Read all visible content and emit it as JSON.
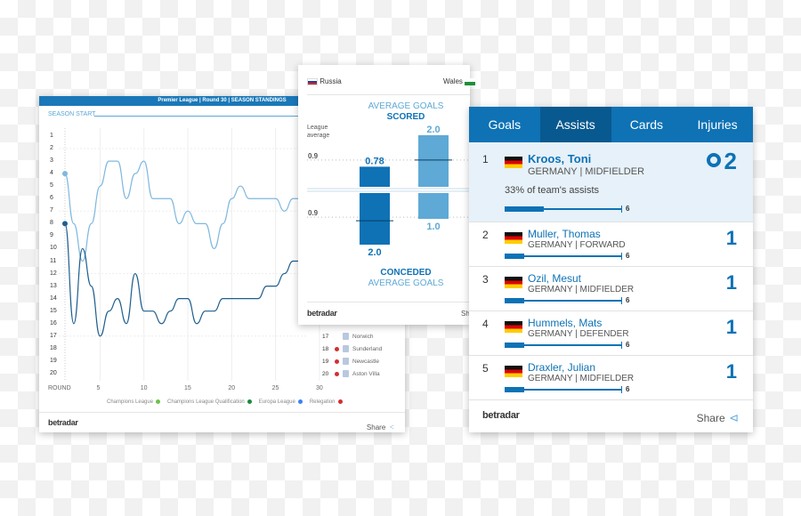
{
  "standings_card": {
    "header": "Premier League | Round 30 | SEASON STANDINGS",
    "season_start": "SEASON START",
    "round_label": "ROUND",
    "legend": [
      {
        "label": "Champions League",
        "color": "#6cc24a"
      },
      {
        "label": "Champions League Qualification",
        "color": "#1b8a3a"
      },
      {
        "label": "Europa League",
        "color": "#3b82f6"
      },
      {
        "label": "Relegation",
        "color": "#d32f2f"
      }
    ],
    "table": [
      {
        "pos": "17",
        "team": "Norwich",
        "zone": ""
      },
      {
        "pos": "18",
        "team": "Sunderland",
        "zone": "#d32f2f"
      },
      {
        "pos": "19",
        "team": "Newcastle",
        "zone": "#d32f2f"
      },
      {
        "pos": "20",
        "team": "Aston Villa",
        "zone": "#d32f2f"
      }
    ],
    "brand": "betradar",
    "share": "Share"
  },
  "chart_data": [
    {
      "type": "line",
      "x_ticks": [
        5,
        10,
        15,
        20,
        25,
        30
      ],
      "y_ticks": [
        1,
        2,
        3,
        4,
        5,
        6,
        7,
        8,
        9,
        10,
        11,
        12,
        13,
        14,
        15,
        16,
        17,
        18,
        19,
        20
      ],
      "xlabel": "ROUND",
      "y_inverted": true,
      "ylim": [
        1,
        20
      ],
      "xlim": [
        1,
        30
      ],
      "series": [
        {
          "color": "#7fb8df",
          "x": [
            1,
            2,
            3,
            4,
            5,
            6,
            7,
            8,
            9,
            10,
            11,
            12,
            13,
            14,
            15,
            16,
            17,
            18,
            19,
            20,
            21,
            22,
            23,
            24,
            25,
            26,
            27,
            28
          ],
          "values": [
            4,
            8,
            11,
            8,
            5,
            3,
            3,
            6,
            4,
            3,
            6,
            6,
            6,
            8,
            7,
            8,
            8,
            10,
            8,
            6,
            5,
            6,
            6,
            6,
            6,
            7,
            6,
            6
          ]
        },
        {
          "color": "#1f5f8f",
          "x": [
            1,
            2,
            3,
            4,
            5,
            6,
            7,
            8,
            9,
            10,
            11,
            12,
            13,
            14,
            15,
            16,
            17,
            18,
            19,
            20,
            21,
            22,
            23,
            24,
            25,
            26,
            27,
            28,
            29,
            30
          ],
          "values": [
            8,
            16,
            10,
            13,
            17,
            15,
            14,
            16,
            12,
            15,
            15,
            16,
            15,
            14,
            14,
            16,
            15,
            15,
            14,
            14,
            14,
            14,
            14,
            13,
            13,
            12,
            11,
            11,
            10,
            9
          ]
        }
      ]
    },
    {
      "type": "bar",
      "title_top": [
        "AVERAGE GOALS",
        "SCORED"
      ],
      "title_bottom": [
        "CONCEDED",
        "AVERAGE GOALS"
      ],
      "league_average_label": [
        "League",
        "average"
      ],
      "league_average": {
        "scored": 0.9,
        "conceded": 0.9
      },
      "series": [
        {
          "name": "Russia",
          "color": "#0e72b5",
          "scored": 0.78,
          "conceded": 2.0
        },
        {
          "name": "Wales",
          "color": "#5ea9d6",
          "scored": 2.0,
          "conceded": 1.0
        }
      ]
    }
  ],
  "compare_card": {
    "home": "Russia",
    "away": "Wales",
    "scored_labels": [
      "0.78",
      "2.0"
    ],
    "conceded_labels": [
      "2.0",
      "1.0"
    ],
    "avg_labels": [
      "0.9",
      "0.9"
    ],
    "brand": "betradar",
    "share": "Sh"
  },
  "leaders_card": {
    "tabs": [
      "Goals",
      "Assists",
      "Cards",
      "Injuries"
    ],
    "active_tab": "Assists",
    "players": [
      {
        "rank": "1",
        "name": "Kroos, Toni",
        "info": "GERMANY | MIDFIELDER",
        "value": "2",
        "share": "33% of team's assists",
        "fraction": 0.33,
        "max": "6"
      },
      {
        "rank": "2",
        "name": "Muller, Thomas",
        "info": "GERMANY | FORWARD",
        "value": "1",
        "fraction": 0.17,
        "max": "6"
      },
      {
        "rank": "3",
        "name": "Ozil, Mesut",
        "info": "GERMANY | MIDFIELDER",
        "value": "1",
        "fraction": 0.17,
        "max": "6"
      },
      {
        "rank": "4",
        "name": "Hummels, Mats",
        "info": "GERMANY | DEFENDER",
        "value": "1",
        "fraction": 0.17,
        "max": "6"
      },
      {
        "rank": "5",
        "name": "Draxler, Julian",
        "info": "GERMANY | MIDFIELDER",
        "value": "1",
        "fraction": 0.17,
        "max": "6"
      }
    ],
    "brand": "betradar",
    "share": "Share",
    "accent": "#0e72b5"
  }
}
